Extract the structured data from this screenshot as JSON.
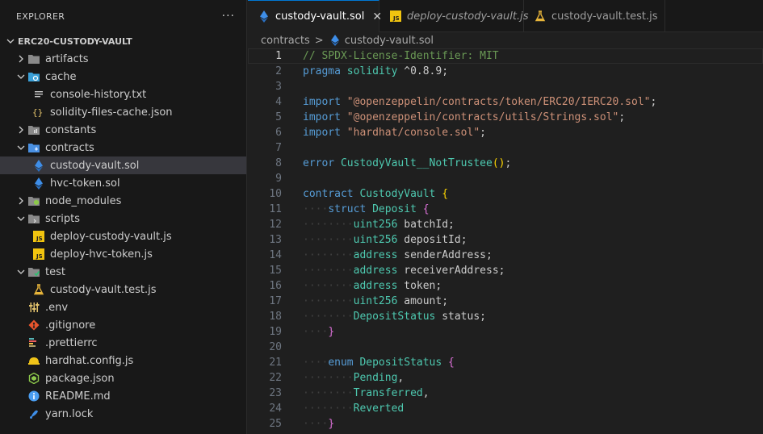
{
  "sidebar": {
    "title": "EXPLORER",
    "more": "···",
    "project": "ERC20-CUSTODY-VAULT",
    "items": [
      {
        "label": "artifacts",
        "depth": 0,
        "chevron": "right",
        "icon": "folder-icon",
        "icon_color": "#8a8a8a"
      },
      {
        "label": "cache",
        "depth": 0,
        "chevron": "down",
        "icon": "cache-folder-icon",
        "icon_color": "#3aa0d8"
      },
      {
        "label": "console-history.txt",
        "depth": 1,
        "chevron": "",
        "icon": "lines-icon",
        "icon_color": "#c8c8c8"
      },
      {
        "label": "solidity-files-cache.json",
        "depth": 1,
        "chevron": "",
        "icon": "braces-icon",
        "icon_color": "#e0c16b"
      },
      {
        "label": "constants",
        "depth": 0,
        "chevron": "right",
        "icon": "constants-folder-icon",
        "icon_color": "#8a8a8a"
      },
      {
        "label": "contracts",
        "depth": 0,
        "chevron": "down",
        "icon": "contracts-folder-icon",
        "icon_color": "#4a90e2"
      },
      {
        "label": "custody-vault.sol",
        "depth": 1,
        "chevron": "",
        "icon": "ethereum-icon",
        "icon_color": "#3e8ee8",
        "selected": true
      },
      {
        "label": "hvc-token.sol",
        "depth": 1,
        "chevron": "",
        "icon": "ethereum-icon",
        "icon_color": "#3e8ee8"
      },
      {
        "label": "node_modules",
        "depth": 0,
        "chevron": "right",
        "icon": "node-folder-icon",
        "icon_color": "#8cc84b"
      },
      {
        "label": "scripts",
        "depth": 0,
        "chevron": "down",
        "icon": "scripts-folder-icon",
        "icon_color": "#8a8a8a"
      },
      {
        "label": "deploy-custody-vault.js",
        "depth": 1,
        "chevron": "",
        "icon": "js-icon",
        "icon_color": "#f1c40f"
      },
      {
        "label": "deploy-hvc-token.js",
        "depth": 1,
        "chevron": "",
        "icon": "js-icon",
        "icon_color": "#f1c40f"
      },
      {
        "label": "test",
        "depth": 0,
        "chevron": "down",
        "icon": "test-folder-icon",
        "icon_color": "#2fbf71"
      },
      {
        "label": "custody-vault.test.js",
        "depth": 1,
        "chevron": "",
        "icon": "flask-icon",
        "icon_color": "#e8b53a"
      },
      {
        "label": ".env",
        "depth": 0,
        "chevron": "",
        "icon": "sliders-icon",
        "icon_color": "#e0c16b"
      },
      {
        "label": ".gitignore",
        "depth": 0,
        "chevron": "",
        "icon": "git-icon",
        "icon_color": "#e8552c"
      },
      {
        "label": ".prettierrc",
        "depth": 0,
        "chevron": "",
        "icon": "prettier-icon",
        "icon_color": "#b0a06a"
      },
      {
        "label": "hardhat.config.js",
        "depth": 0,
        "chevron": "",
        "icon": "hardhat-icon",
        "icon_color": "#f0c419"
      },
      {
        "label": "package.json",
        "depth": 0,
        "chevron": "",
        "icon": "node-hex-icon",
        "icon_color": "#8cc84b"
      },
      {
        "label": "README.md",
        "depth": 0,
        "chevron": "",
        "icon": "info-icon",
        "icon_color": "#4a9df0"
      },
      {
        "label": "yarn.lock",
        "depth": 0,
        "chevron": "",
        "icon": "yarn-icon",
        "icon_color": "#3e8ee8"
      }
    ]
  },
  "tabs": [
    {
      "label": "custody-vault.sol",
      "icon": "ethereum-icon",
      "active": true,
      "italic": false,
      "close": "✕"
    },
    {
      "label": "deploy-custody-vault.js",
      "icon": "js-icon",
      "active": false,
      "italic": true,
      "close": ""
    },
    {
      "label": "custody-vault.test.js",
      "icon": "flask-icon",
      "active": false,
      "italic": false,
      "close": ""
    }
  ],
  "breadcrumb": {
    "folder": "contracts",
    "separator": ">",
    "file": "custody-vault.sol"
  },
  "editor": {
    "current_line": 1,
    "lines": [
      {
        "n": "1",
        "indent": 0,
        "tokens": [
          [
            "t-comment",
            "// SPDX-License-Identifier: MIT"
          ]
        ]
      },
      {
        "n": "2",
        "indent": 0,
        "tokens": [
          [
            "t-kw",
            "pragma"
          ],
          [
            "t-plain",
            " "
          ],
          [
            "t-type",
            "solidity"
          ],
          [
            "t-plain",
            " ^0.8.9;"
          ]
        ]
      },
      {
        "n": "3",
        "indent": 0,
        "tokens": []
      },
      {
        "n": "4",
        "indent": 0,
        "tokens": [
          [
            "t-kw",
            "import"
          ],
          [
            "t-plain",
            " "
          ],
          [
            "t-str",
            "\"@openzeppelin/contracts/token/ERC20/IERC20.sol\""
          ],
          [
            "t-plain",
            ";"
          ]
        ]
      },
      {
        "n": "5",
        "indent": 0,
        "tokens": [
          [
            "t-kw",
            "import"
          ],
          [
            "t-plain",
            " "
          ],
          [
            "t-str",
            "\"@openzeppelin/contracts/utils/Strings.sol\""
          ],
          [
            "t-plain",
            ";"
          ]
        ]
      },
      {
        "n": "6",
        "indent": 0,
        "tokens": [
          [
            "t-kw",
            "import"
          ],
          [
            "t-plain",
            " "
          ],
          [
            "t-str",
            "\"hardhat/console.sol\""
          ],
          [
            "t-plain",
            ";"
          ]
        ]
      },
      {
        "n": "7",
        "indent": 0,
        "tokens": []
      },
      {
        "n": "8",
        "indent": 0,
        "tokens": [
          [
            "t-kw",
            "error"
          ],
          [
            "t-plain",
            " "
          ],
          [
            "t-fn",
            "CustodyVault__NotTrustee"
          ],
          [
            "t-paren",
            "()"
          ],
          [
            "t-plain",
            ";"
          ]
        ]
      },
      {
        "n": "9",
        "indent": 0,
        "tokens": []
      },
      {
        "n": "10",
        "indent": 0,
        "tokens": [
          [
            "t-kw",
            "contract"
          ],
          [
            "t-plain",
            " "
          ],
          [
            "t-type",
            "CustodyVault"
          ],
          [
            "t-plain",
            " "
          ],
          [
            "t-brace2",
            "{"
          ]
        ]
      },
      {
        "n": "11",
        "indent": 1,
        "tokens": [
          [
            "t-kw",
            "struct"
          ],
          [
            "t-plain",
            " "
          ],
          [
            "t-type",
            "Deposit"
          ],
          [
            "t-plain",
            " "
          ],
          [
            "t-brace",
            "{"
          ]
        ]
      },
      {
        "n": "12",
        "indent": 2,
        "tokens": [
          [
            "t-type",
            "uint256"
          ],
          [
            "t-plain",
            " batchId;"
          ]
        ]
      },
      {
        "n": "13",
        "indent": 2,
        "tokens": [
          [
            "t-type",
            "uint256"
          ],
          [
            "t-plain",
            " depositId;"
          ]
        ]
      },
      {
        "n": "14",
        "indent": 2,
        "tokens": [
          [
            "t-type",
            "address"
          ],
          [
            "t-plain",
            " senderAddress;"
          ]
        ]
      },
      {
        "n": "15",
        "indent": 2,
        "tokens": [
          [
            "t-type",
            "address"
          ],
          [
            "t-plain",
            " receiverAddress;"
          ]
        ]
      },
      {
        "n": "16",
        "indent": 2,
        "tokens": [
          [
            "t-type",
            "address"
          ],
          [
            "t-plain",
            " token;"
          ]
        ]
      },
      {
        "n": "17",
        "indent": 2,
        "tokens": [
          [
            "t-type",
            "uint256"
          ],
          [
            "t-plain",
            " amount;"
          ]
        ]
      },
      {
        "n": "18",
        "indent": 2,
        "tokens": [
          [
            "t-type",
            "DepositStatus"
          ],
          [
            "t-plain",
            " status;"
          ]
        ]
      },
      {
        "n": "19",
        "indent": 1,
        "tokens": [
          [
            "t-brace",
            "}"
          ]
        ]
      },
      {
        "n": "20",
        "indent": 0,
        "tokens": []
      },
      {
        "n": "21",
        "indent": 1,
        "tokens": [
          [
            "t-kw",
            "enum"
          ],
          [
            "t-plain",
            " "
          ],
          [
            "t-type",
            "DepositStatus"
          ],
          [
            "t-plain",
            " "
          ],
          [
            "t-brace",
            "{"
          ]
        ]
      },
      {
        "n": "22",
        "indent": 2,
        "tokens": [
          [
            "t-type",
            "Pending"
          ],
          [
            "t-plain",
            ","
          ]
        ]
      },
      {
        "n": "23",
        "indent": 2,
        "tokens": [
          [
            "t-type",
            "Transferred"
          ],
          [
            "t-plain",
            ","
          ]
        ]
      },
      {
        "n": "24",
        "indent": 2,
        "tokens": [
          [
            "t-type",
            "Reverted"
          ]
        ]
      },
      {
        "n": "25",
        "indent": 1,
        "tokens": [
          [
            "t-brace",
            "}"
          ]
        ]
      }
    ]
  }
}
